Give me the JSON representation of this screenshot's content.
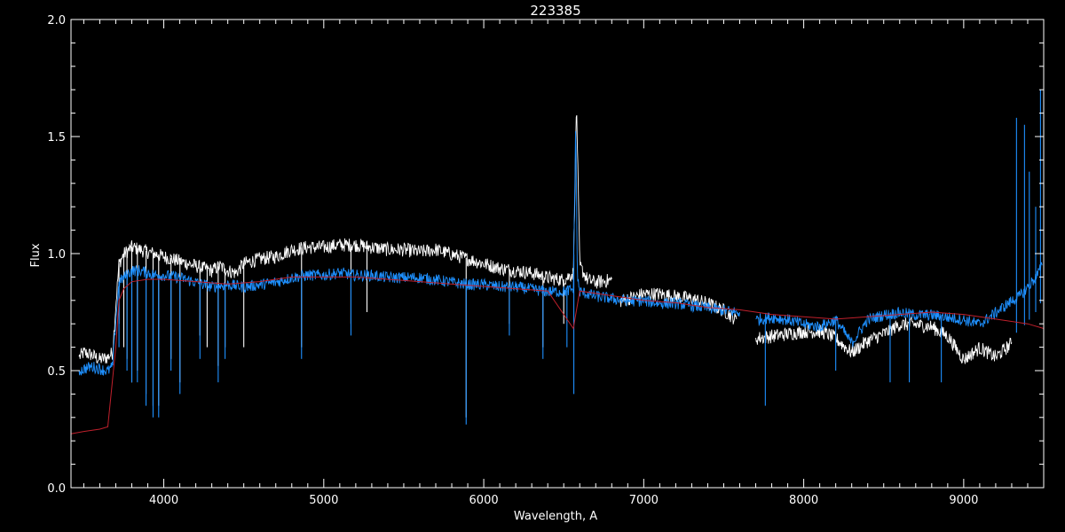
{
  "chart_data": {
    "type": "line",
    "title": "223385",
    "xlabel": "Wavelength, A",
    "ylabel": "Flux",
    "xlim": [
      3420,
      9500
    ],
    "ylim": [
      0,
      2.0
    ],
    "xticks": [
      4000,
      5000,
      6000,
      7000,
      8000,
      9000
    ],
    "xtick_labels": [
      "4000",
      "5000",
      "6000",
      "7000",
      "8000",
      "9000"
    ],
    "yticks": [
      0,
      0.5,
      1.0,
      1.5,
      2.0
    ],
    "ytick_labels": [
      "0.0",
      "0.5",
      "1.0",
      "1.5",
      "2.0"
    ],
    "grid": false,
    "colors": {
      "background": "#000000",
      "axes": "#ffffff",
      "white_series": "#ffffff",
      "blue_series": "#1e90ff",
      "red_series": "#c0202c"
    },
    "series": [
      {
        "color": "#ffffff",
        "segments": [
          {
            "x": [
              3470,
              3500,
              3550,
              3600,
              3650,
              3680,
              3700,
              3720,
              3750,
              3800,
              3850,
              3900,
              3950,
              4000,
              4100,
              4200,
              4300,
              4350,
              4400,
              4450,
              4500,
              4550,
              4600,
              4700,
              4800,
              4900,
              5000,
              5100,
              5200,
              5300,
              5400,
              5500,
              5600,
              5700,
              5800,
              5900,
              6000,
              6100,
              6200,
              6300,
              6400,
              6500,
              6560,
              6580,
              6600,
              6650,
              6700,
              6800
            ],
            "y": [
              0.56,
              0.58,
              0.57,
              0.55,
              0.56,
              0.58,
              0.78,
              0.96,
              1.0,
              1.03,
              1.02,
              1.01,
              1.0,
              0.99,
              0.97,
              0.95,
              0.93,
              0.95,
              0.93,
              0.92,
              0.96,
              0.97,
              0.98,
              0.99,
              1.02,
              1.03,
              1.03,
              1.04,
              1.04,
              1.03,
              1.02,
              1.02,
              1.01,
              1.02,
              1.0,
              0.98,
              0.96,
              0.94,
              0.93,
              0.92,
              0.9,
              0.89,
              0.92,
              1.65,
              0.95,
              0.89,
              0.88,
              0.89
            ]
          },
          {
            "x": [
              6850,
              6900,
              7000,
              7100,
              7200,
              7300,
              7400,
              7500,
              7580
            ],
            "y": [
              0.8,
              0.81,
              0.83,
              0.83,
              0.82,
              0.81,
              0.79,
              0.76,
              0.72
            ]
          },
          {
            "x": [
              7700,
              7800,
              7900,
              8000,
              8100,
              8150,
              8200,
              8300,
              8400,
              8500,
              8600,
              8700,
              8800,
              8900,
              9000,
              9100,
              9200,
              9300
            ],
            "y": [
              0.64,
              0.65,
              0.66,
              0.67,
              0.67,
              0.66,
              0.64,
              0.58,
              0.63,
              0.66,
              0.7,
              0.7,
              0.69,
              0.65,
              0.55,
              0.6,
              0.56,
              0.62
            ]
          }
        ],
        "absorption_lines": [
          [
            3720,
            0.7
          ],
          [
            3750,
            0.6
          ],
          [
            3770,
            0.55
          ],
          [
            3800,
            0.45
          ],
          [
            3835,
            0.5
          ],
          [
            3889,
            0.4
          ],
          [
            3933,
            0.35
          ],
          [
            3968,
            0.35
          ],
          [
            4045,
            0.55
          ],
          [
            4101,
            0.45
          ],
          [
            4226,
            0.65
          ],
          [
            4271,
            0.6
          ],
          [
            4340,
            0.52
          ],
          [
            4383,
            0.6
          ],
          [
            4500,
            0.6
          ],
          [
            4861,
            0.6
          ],
          [
            5170,
            0.7
          ],
          [
            5270,
            0.75
          ],
          [
            5890,
            0.3
          ],
          [
            6160,
            0.7
          ],
          [
            6370,
            0.6
          ],
          [
            6500,
            0.7
          ]
        ]
      },
      {
        "color": "#1e90ff",
        "segments": [
          {
            "x": [
              3470,
              3500,
              3550,
              3600,
              3650,
              3680,
              3700,
              3720,
              3750,
              3800,
              3850,
              3900,
              3950,
              4000,
              4100,
              4200,
              4300,
              4400,
              4500,
              4600,
              4700,
              4800,
              4900,
              5000,
              5100,
              5200,
              5300,
              5400,
              5500,
              5600,
              5700,
              5800,
              5900,
              6000,
              6100,
              6200,
              6300,
              6400,
              6500,
              6560,
              6575,
              6585,
              6600,
              6700,
              6800,
              6900,
              7000,
              7100,
              7200,
              7300,
              7400,
              7500,
              7600
            ],
            "y": [
              0.5,
              0.51,
              0.52,
              0.51,
              0.5,
              0.52,
              0.72,
              0.88,
              0.9,
              0.93,
              0.93,
              0.92,
              0.91,
              0.91,
              0.9,
              0.88,
              0.86,
              0.87,
              0.86,
              0.87,
              0.88,
              0.9,
              0.91,
              0.91,
              0.92,
              0.91,
              0.91,
              0.9,
              0.9,
              0.9,
              0.89,
              0.88,
              0.87,
              0.87,
              0.86,
              0.86,
              0.85,
              0.84,
              0.84,
              0.85,
              1.58,
              0.9,
              0.84,
              0.82,
              0.81,
              0.8,
              0.8,
              0.79,
              0.79,
              0.78,
              0.77,
              0.76,
              0.75
            ]
          },
          {
            "x": [
              7700,
              7800,
              7900,
              8000,
              8100,
              8200,
              8300,
              8400,
              8500,
              8600,
              8700,
              8800,
              8900,
              9000,
              9100,
              9200,
              9300,
              9350,
              9400,
              9450,
              9490
            ],
            "y": [
              0.72,
              0.73,
              0.72,
              0.7,
              0.69,
              0.72,
              0.62,
              0.72,
              0.74,
              0.75,
              0.74,
              0.74,
              0.73,
              0.72,
              0.7,
              0.75,
              0.8,
              0.82,
              0.86,
              0.9,
              0.95
            ]
          }
        ],
        "absorption_lines": [
          [
            3720,
            0.6
          ],
          [
            3770,
            0.5
          ],
          [
            3800,
            0.45
          ],
          [
            3835,
            0.45
          ],
          [
            3889,
            0.35
          ],
          [
            3933,
            0.3
          ],
          [
            3968,
            0.3
          ],
          [
            4045,
            0.5
          ],
          [
            4101,
            0.4
          ],
          [
            4226,
            0.55
          ],
          [
            4340,
            0.45
          ],
          [
            4383,
            0.55
          ],
          [
            4861,
            0.55
          ],
          [
            5170,
            0.65
          ],
          [
            5890,
            0.27
          ],
          [
            6160,
            0.65
          ],
          [
            6370,
            0.55
          ],
          [
            6520,
            0.6
          ],
          [
            6563,
            0.4
          ],
          [
            7760,
            0.35
          ],
          [
            8200,
            0.5
          ],
          [
            8540,
            0.45
          ],
          [
            8660,
            0.45
          ],
          [
            8860,
            0.45
          ]
        ],
        "emission_spikes": [
          [
            9330,
            1.58
          ],
          [
            9380,
            1.55
          ],
          [
            9410,
            1.35
          ],
          [
            9450,
            1.2
          ],
          [
            9480,
            1.7
          ]
        ]
      },
      {
        "color": "#c0202c",
        "x": [
          3420,
          3500,
          3600,
          3650,
          3700,
          3720,
          3750,
          3800,
          3900,
          4000,
          4200,
          4400,
          4600,
          4800,
          5000,
          5200,
          5400,
          5600,
          5800,
          6000,
          6200,
          6400,
          6560,
          6600,
          6800,
          7000,
          7200,
          7400,
          7600,
          7800,
          8000,
          8200,
          8400,
          8600,
          8800,
          9000,
          9200,
          9400,
          9500
        ],
        "y": [
          0.23,
          0.24,
          0.25,
          0.26,
          0.6,
          0.8,
          0.85,
          0.88,
          0.89,
          0.89,
          0.88,
          0.87,
          0.88,
          0.9,
          0.9,
          0.9,
          0.89,
          0.88,
          0.87,
          0.86,
          0.85,
          0.84,
          0.68,
          0.84,
          0.82,
          0.8,
          0.79,
          0.77,
          0.76,
          0.74,
          0.73,
          0.72,
          0.73,
          0.74,
          0.75,
          0.74,
          0.72,
          0.7,
          0.68
        ]
      }
    ]
  }
}
